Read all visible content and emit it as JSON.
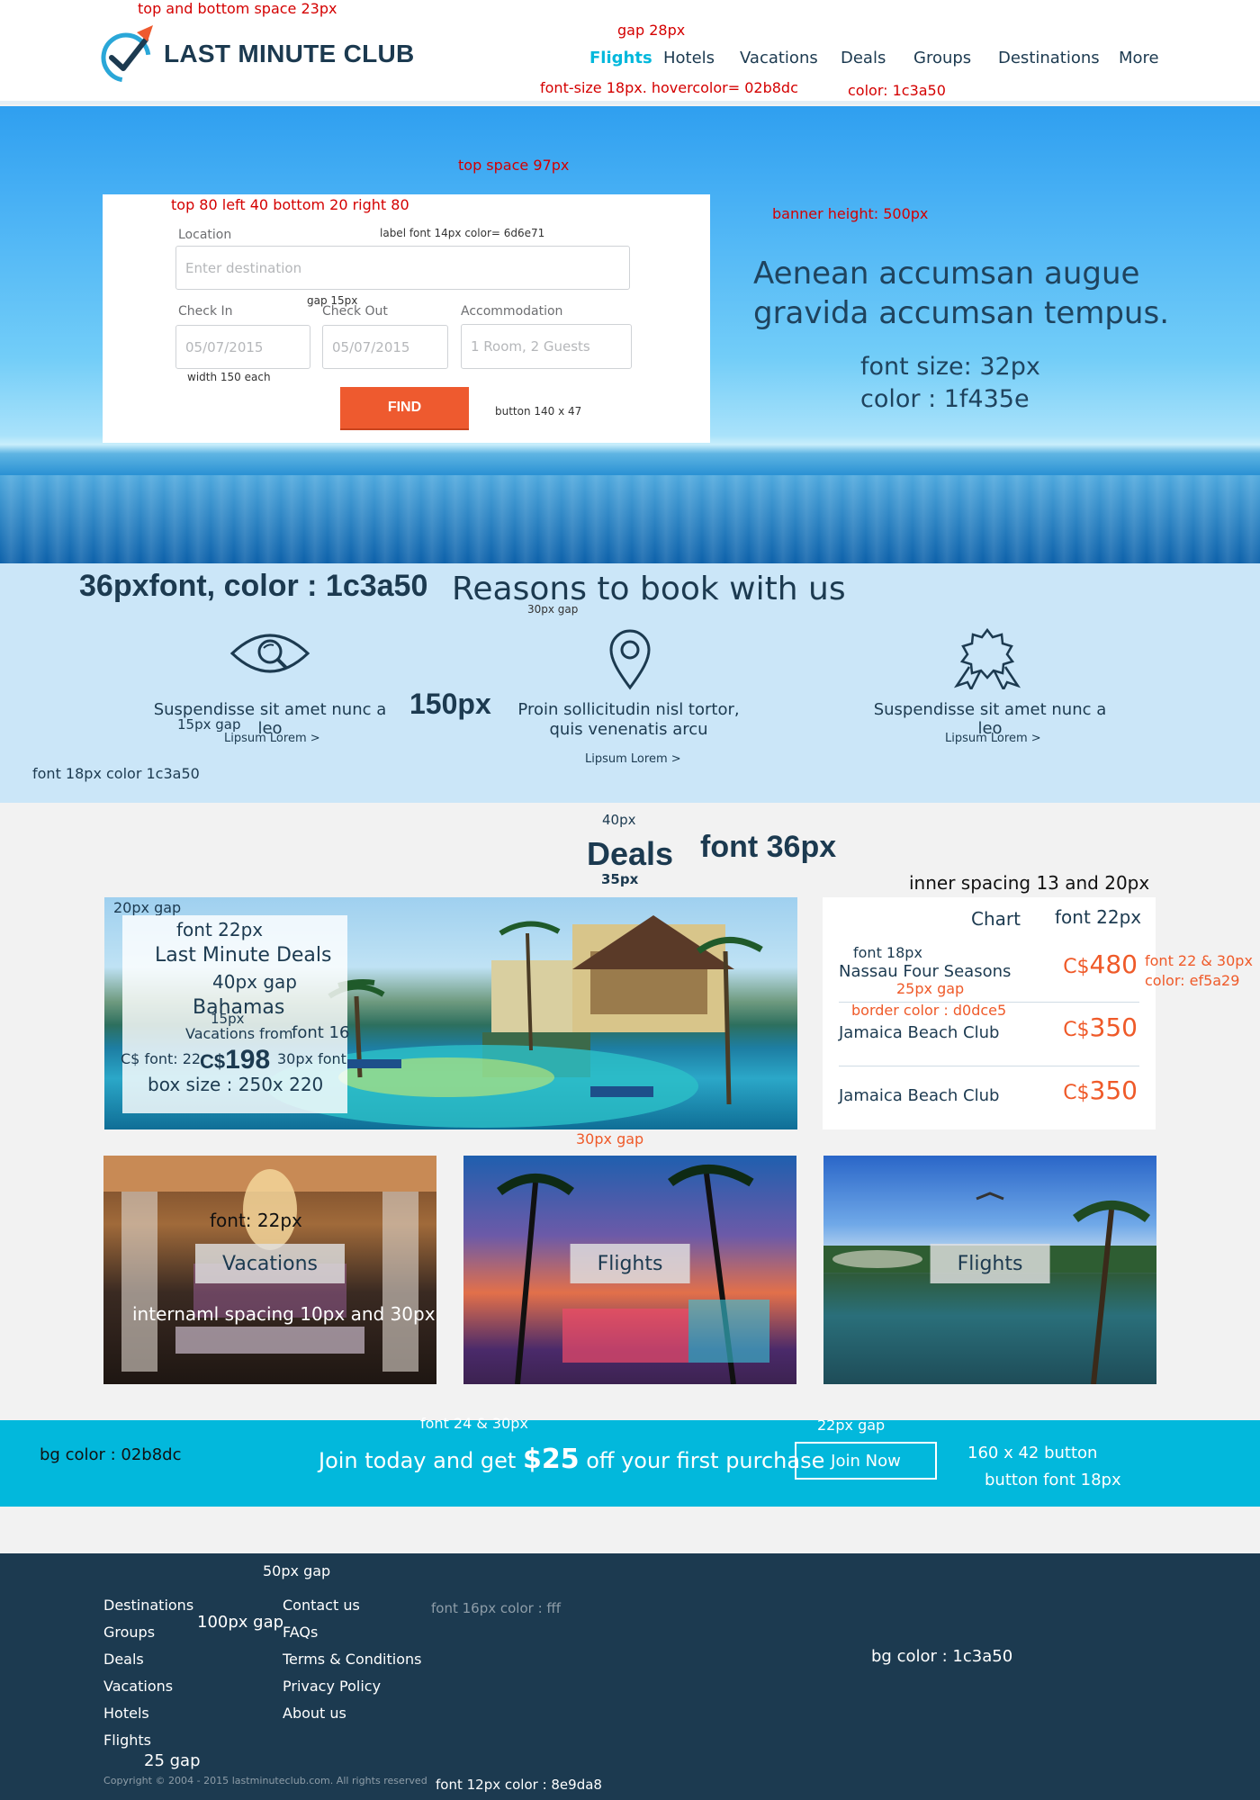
{
  "header": {
    "logo": "LAST MINUTE CLUB",
    "nav": [
      {
        "label": "Flights",
        "active": true
      },
      {
        "label": "Hotels"
      },
      {
        "label": "Vacations"
      },
      {
        "label": "Deals"
      },
      {
        "label": "Groups"
      },
      {
        "label": "Destinations"
      },
      {
        "label": "More"
      }
    ]
  },
  "search": {
    "location_label": "Location",
    "location_placeholder": "Enter destination",
    "checkin_label": "Check In",
    "checkin_placeholder": "05/07/2015",
    "checkout_label": "Check Out",
    "checkout_placeholder": "05/07/2015",
    "accommodation_label": "Accommodation",
    "accommodation_placeholder": "1 Room, 2 Guests",
    "find_button": "FIND"
  },
  "hero": {
    "tagline_line1": "Aenean accumsan augue",
    "tagline_line2": "gravida accumsan tempus."
  },
  "reasons": {
    "title": "Reasons to book with us",
    "items": [
      {
        "icon": "eye-search-icon",
        "text": "Suspendisse sit amet nunc a leo",
        "link": "Lipsum Lorem >"
      },
      {
        "icon": "map-pin-icon",
        "text": "Proin sollicitudin nisl tortor, quis venenatis arcu",
        "link": "Lipsum Lorem >"
      },
      {
        "icon": "award-badge-icon",
        "text": "Suspendisse sit amet nunc a leo",
        "link": "Lipsum Lorem >"
      }
    ]
  },
  "deals": {
    "title": "Deals",
    "feature": {
      "heading": "Last Minute Deals",
      "destination": "Bahamas",
      "from_label": "Vacations from",
      "currency": "C$",
      "price": "198"
    },
    "chart": {
      "title": "Chart",
      "rows": [
        {
          "name": "Nassau Four Seasons",
          "currency": "C$",
          "price": "480"
        },
        {
          "name": "Jamaica Beach Club",
          "currency": "C$",
          "price": "350"
        },
        {
          "name": "Jamaica Beach Club",
          "currency": "C$",
          "price": "350"
        }
      ]
    },
    "tiles": [
      {
        "label": "Vacations"
      },
      {
        "label": "Flights"
      },
      {
        "label": "Flights"
      }
    ]
  },
  "cta": {
    "text_before": "Join today and get ",
    "amount": "$25",
    "text_after": " off your first purchase",
    "button": "Join Now"
  },
  "footer": {
    "col1": [
      "Destinations",
      "Groups",
      "Deals",
      "Vacations",
      "Hotels",
      "Flights"
    ],
    "col2": [
      "Contact us",
      "FAQs",
      "Terms & Conditions",
      "Privacy Policy",
      "About us"
    ],
    "copyright": "Copyright © 2004 - 2015 lastminuteclub.com. All rights reserved"
  },
  "annotations": {
    "a1": "top and bottom space 23px",
    "a2": "gap 28px",
    "a3": "font-size 18px. hovercolor= 02b8dc",
    "a4": "color: 1c3a50",
    "a5": "top space 97px",
    "a6": "top 80 left 40 bottom 20 right 80",
    "a7": "banner height: 500px",
    "a8": "label font 14px color= 6d6e71",
    "a9": "gap 15px",
    "a10": "width 150 each",
    "a11": "button 140 x 47",
    "a12": "font size: 32px",
    "a13": "color : 1f435e",
    "a14": "36pxfont, color : 1c3a50",
    "a15": "30px gap",
    "a16": "15px gap",
    "a17": "150px",
    "a18": "font 18px color 1c3a50",
    "a19": "40px",
    "a20": "35px",
    "a21": "font 36px",
    "a22": "inner spacing 13 and 20px",
    "a23": "20px gap",
    "a24": "font 22px",
    "a25": "40px gap",
    "a26": "15px",
    "a27": "font 16",
    "a28": "C$ font: 22",
    "a29": "30px font",
    "a30": "box size : 250x 220",
    "a31": "font 22px",
    "a32": "font 18px",
    "a33": "25px gap",
    "a34": "border color : d0dce5",
    "a35": "font 22 & 30px",
    "a36": "color: ef5a29",
    "a37": "30px gap",
    "a38": "font: 22px",
    "a39": "internaml spacing 10px and 30px",
    "a40": "bg color : 02b8dc",
    "a41": "font 24 & 30px",
    "a42": "22px gap",
    "a43": "160 x 42 button",
    "a44": "button font 18px",
    "a45": "50px gap",
    "a46": "100px gap",
    "a47": "font 16px color : fff",
    "a48": "bg color : 1c3a50",
    "a49": "25 gap",
    "a50": "font 12px color : 8e9da8"
  }
}
